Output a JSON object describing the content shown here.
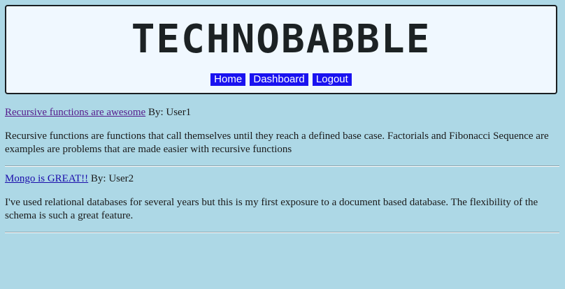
{
  "header": {
    "logo_text": "TECHNOBABBLE",
    "nav": [
      {
        "label": "Home"
      },
      {
        "label": "Dashboard"
      },
      {
        "label": "Logout"
      }
    ]
  },
  "posts": [
    {
      "title": "Recursive functions are awesome",
      "byline": "By: User1",
      "body": "Recursive functions are functions that call themselves until they reach a defined base case. Factorials and Fibonacci Sequence are examples are problems that are made easier with recursive functions"
    },
    {
      "title": "Mongo is GREAT!!",
      "byline": "By: User2",
      "body": "I've used relational databases for several years but this is my first exposure to a document based database. The flexibility of the schema is such a great feature."
    }
  ],
  "colors": {
    "page_background": "#add8e6",
    "header_background": "#f0f8ff",
    "nav_button": "#1a12f0",
    "link_visited": "#551a8b",
    "link": "#1a0dab"
  }
}
